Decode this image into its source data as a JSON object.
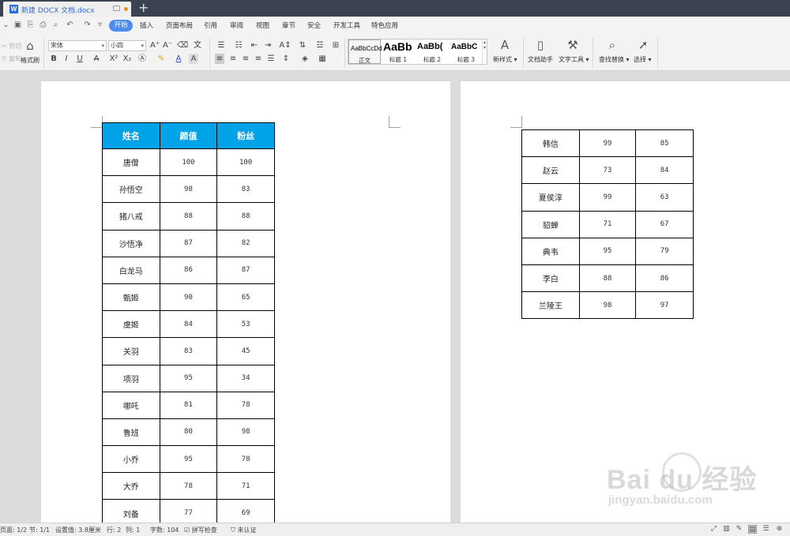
{
  "titlebar": {
    "tab_title": "新建 DOCX 文档.docx",
    "word_icon": "W",
    "new_tab_icon": "plus-icon"
  },
  "menu": {
    "active": "开始",
    "items": [
      "插入",
      "页面布局",
      "引用",
      "审阅",
      "视图",
      "章节",
      "安全",
      "开发工具",
      "特色应用"
    ]
  },
  "toolbar": {
    "cut_label": "剪切",
    "copy_label": "复制",
    "format_painter_label": "格式刷",
    "font_name": "宋体",
    "font_size": "小四",
    "styles": [
      {
        "sample": "AaBbCcDd",
        "name": "正文"
      },
      {
        "sample": "AaBb",
        "name": "标题 1"
      },
      {
        "sample": "AaBb(",
        "name": "标题 2"
      },
      {
        "sample": "AaBbC",
        "name": "标题 3"
      }
    ],
    "new_style_label": "新样式",
    "doc_helper_label": "文档助手",
    "text_tools_label": "文字工具",
    "find_replace_label": "查找替换",
    "select_label": "选择"
  },
  "table1": {
    "headers": [
      "姓名",
      "颜值",
      "粉丝"
    ],
    "header_color": "#00a2e8",
    "rows": [
      [
        "唐僧",
        "100",
        "100"
      ],
      [
        "孙悟空",
        "98",
        "83"
      ],
      [
        "猪八戒",
        "88",
        "88"
      ],
      [
        "沙悟净",
        "87",
        "82"
      ],
      [
        "白龙马",
        "86",
        "87"
      ],
      [
        "甄姬",
        "90",
        "65"
      ],
      [
        "虞姬",
        "84",
        "53"
      ],
      [
        "关羽",
        "83",
        "45"
      ],
      [
        "项羽",
        "95",
        "34"
      ],
      [
        "哪吒",
        "81",
        "78"
      ],
      [
        "鲁班",
        "80",
        "98"
      ],
      [
        "小乔",
        "95",
        "78"
      ],
      [
        "大乔",
        "78",
        "71"
      ],
      [
        "刘备",
        "77",
        "69"
      ]
    ]
  },
  "table2": {
    "rows": [
      [
        "韩信",
        "99",
        "85"
      ],
      [
        "赵云",
        "73",
        "84"
      ],
      [
        "夏侯淳",
        "99",
        "63"
      ],
      [
        "貂蝉",
        "71",
        "67"
      ],
      [
        "典韦",
        "95",
        "79"
      ],
      [
        "李白",
        "88",
        "86"
      ],
      [
        "兰陵王",
        "98",
        "97"
      ]
    ]
  },
  "watermark": {
    "brand": "Bai du 经验",
    "url": "jingyan.baidu.com"
  },
  "statusbar": {
    "page": "页面: 1/2",
    "section": "节: 1/1",
    "position": "设置值: 3.8厘米",
    "row": "行: 2",
    "col": "列: 1",
    "word_count": "字数: 104",
    "spell_check": "拼写检查",
    "cert": "未认证"
  }
}
